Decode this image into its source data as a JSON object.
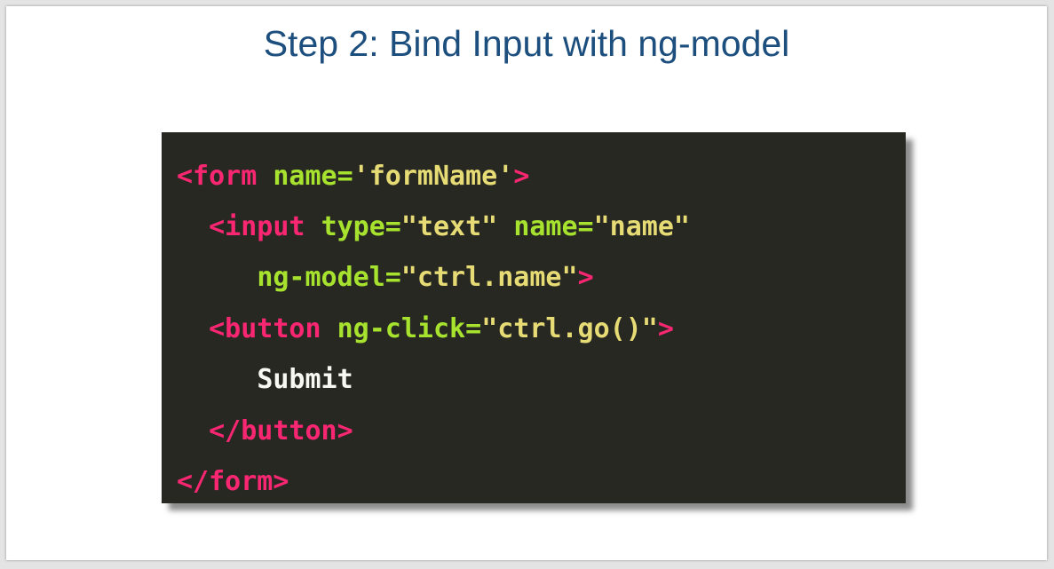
{
  "slide": {
    "title": "Step 2: Bind Input with ng-model"
  },
  "code": {
    "lines": [
      {
        "tokens": [
          {
            "text": "<form",
            "kind": "tag"
          },
          {
            "text": " ",
            "kind": "text"
          },
          {
            "text": "name=",
            "kind": "attr"
          },
          {
            "text": "'formName'",
            "kind": "str"
          },
          {
            "text": ">",
            "kind": "tag"
          }
        ]
      },
      {
        "tokens": [
          {
            "text": "  ",
            "kind": "text"
          },
          {
            "text": "<input",
            "kind": "tag"
          },
          {
            "text": " ",
            "kind": "text"
          },
          {
            "text": "type=",
            "kind": "attr"
          },
          {
            "text": "\"text\"",
            "kind": "str"
          },
          {
            "text": " ",
            "kind": "text"
          },
          {
            "text": "name=",
            "kind": "attr"
          },
          {
            "text": "\"name\"",
            "kind": "str"
          }
        ]
      },
      {
        "tokens": [
          {
            "text": "     ",
            "kind": "text"
          },
          {
            "text": "ng-model=",
            "kind": "attr"
          },
          {
            "text": "\"ctrl.name\"",
            "kind": "str"
          },
          {
            "text": ">",
            "kind": "tag"
          }
        ]
      },
      {
        "tokens": [
          {
            "text": "  ",
            "kind": "text"
          },
          {
            "text": "<button",
            "kind": "tag"
          },
          {
            "text": " ",
            "kind": "text"
          },
          {
            "text": "ng-click=",
            "kind": "attr"
          },
          {
            "text": "\"ctrl.go()\"",
            "kind": "str"
          },
          {
            "text": ">",
            "kind": "tag"
          }
        ]
      },
      {
        "tokens": [
          {
            "text": "     ",
            "kind": "text"
          },
          {
            "text": "Submit",
            "kind": "text"
          }
        ]
      },
      {
        "tokens": [
          {
            "text": "  ",
            "kind": "text"
          },
          {
            "text": "</button>",
            "kind": "tag"
          }
        ]
      },
      {
        "tokens": [
          {
            "text": "</form>",
            "kind": "tag"
          }
        ]
      }
    ]
  },
  "colors": {
    "title": "#1c4e7e",
    "code_background": "#272822",
    "tag": "#f92672",
    "attribute": "#a6e22e",
    "string": "#e6db74",
    "text": "#f8f8f2"
  }
}
